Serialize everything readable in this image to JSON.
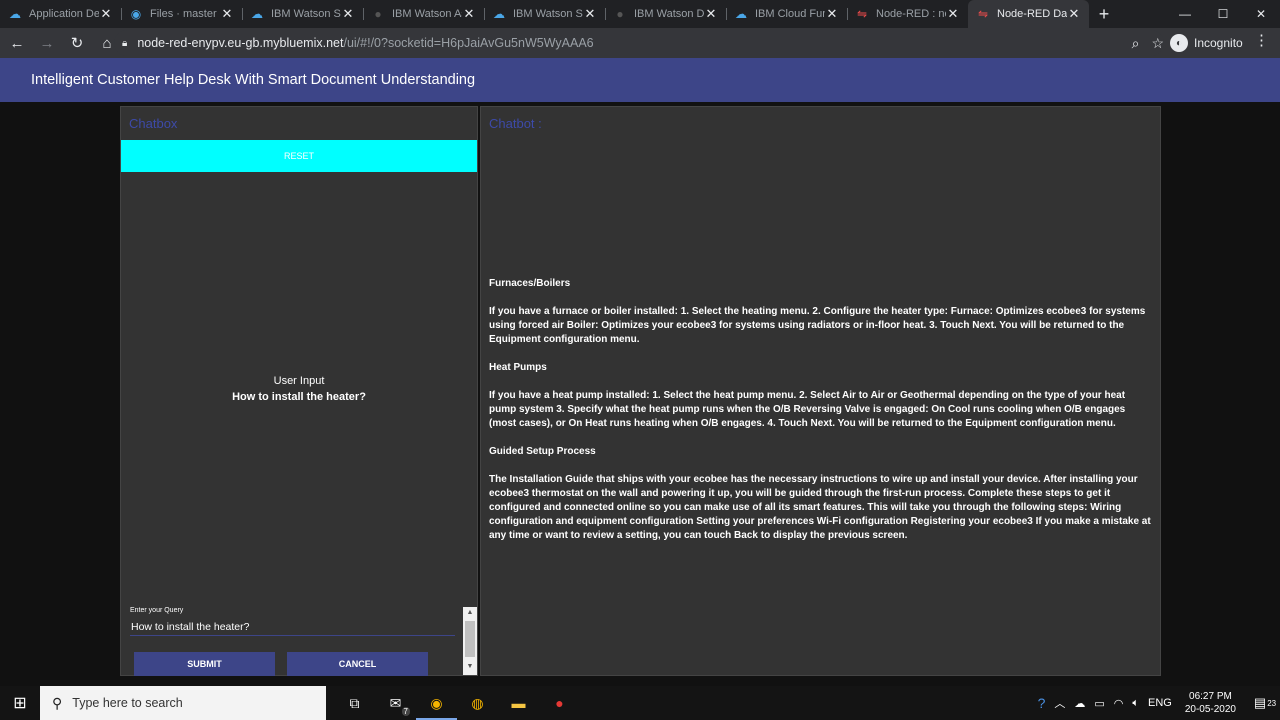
{
  "browser": {
    "tabs": [
      {
        "title": "Application De",
        "icon": "ibm-cloud-icon"
      },
      {
        "title": "Files · master ·",
        "icon": "ibm-files-icon"
      },
      {
        "title": "IBM Watson Se",
        "icon": "ibm-cloud-icon"
      },
      {
        "title": "IBM Watson As",
        "icon": "watson-icon"
      },
      {
        "title": "IBM Watson Se",
        "icon": "ibm-cloud-icon"
      },
      {
        "title": "IBM Watson Di",
        "icon": "watson-icon"
      },
      {
        "title": "IBM Cloud Fun",
        "icon": "ibm-cloud-icon"
      },
      {
        "title": "Node-RED : no",
        "icon": "node-red-icon"
      },
      {
        "title": "Node-RED Das",
        "icon": "node-red-icon"
      }
    ],
    "active_tab": 8,
    "url_host": "node-red-enypv.eu-gb.mybluemix.net",
    "url_path": "/ui/#!/0?socketid=H6pJaiAvGu5nW5WyAAA6",
    "profile": "Incognito"
  },
  "app": {
    "title": "Intelligent Customer Help Desk With Smart Document Understanding"
  },
  "chatbox": {
    "title": "Chatbox",
    "reset_label": "RESET",
    "user_input_label": "User Input",
    "user_input_value": "How to install the heater?",
    "query_label": "Enter your Query",
    "query_value": "How to install the heater?",
    "submit_label": "SUBMIT",
    "cancel_label": "CANCEL"
  },
  "chatbot": {
    "title": "Chatbot :",
    "paragraphs": [
      "Furnaces/Boilers",
      "If you have a furnace or boiler installed: 1. Select the heating menu. 2. Configure the heater type:  Furnace: Optimizes ecobee3 for systems using forced air  Boiler: Optimizes your ecobee3 for systems using radiators or in-floor heat. 3. Touch Next. You will be returned to the Equipment configuration menu.",
      "Heat Pumps",
      "If you have a heat pump installed: 1. Select the heat pump menu. 2. Select Air to Air or Geothermal depending on the type of your heat pump system 3. Specify what the heat pump runs when the O/B Reversing Valve is engaged: On Cool runs cooling when O/B engages (most cases), or On Heat runs heating when O/B engages. 4. Touch Next. You will be returned to the Equipment configuration menu.",
      "Guided Setup Process",
      "The Installation Guide that ships with your ecobee has the necessary instructions to wire up and install your device. After installing your ecobee3 thermostat on the wall and powering it up, you will be guided through the first-run process. Complete these steps to get it configured and connected online so you can make use of all its smart features. This will take you through the following steps:  Wiring configuration and equipment configuration Setting your preferences  Wi-Fi configuration Registering your ecobee3 If you make a mistake at any time or want to review a setting, you can touch Back to display the previous screen."
    ]
  },
  "taskbar": {
    "search_placeholder": "Type here to search",
    "mail_badge": "7",
    "language": "ENG",
    "time": "06:27 PM",
    "date": "20-05-2020",
    "notification_count": "23"
  },
  "colors": {
    "header_bg": "#3d4588",
    "reset_bg": "#00ffff",
    "panel_bg": "#333333",
    "page_bg": "#111111"
  }
}
